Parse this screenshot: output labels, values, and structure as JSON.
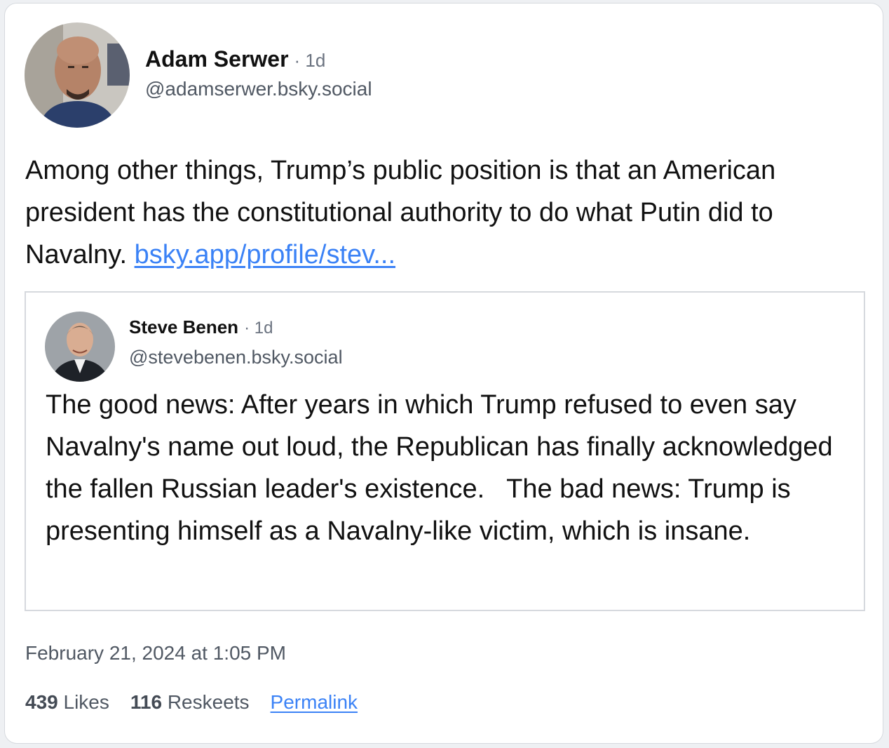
{
  "post": {
    "author": {
      "display_name": "Adam Serwer",
      "time_ago": "· 1d",
      "handle": "@adamserwer.bsky.social"
    },
    "text": "Among other things, Trump’s public position is that an American president has the constitutional authority to do what Putin did to Navalny. ",
    "link_text": "bsky.app/profile/stev...",
    "timestamp": "February 21, 2024 at 1:05 PM",
    "likes_count": "439",
    "likes_label": "Likes",
    "reskeets_count": "116",
    "reskeets_label": "Reskeets",
    "permalink_label": "Permalink"
  },
  "quote": {
    "author": {
      "display_name": "Steve Benen",
      "time_ago": "· 1d",
      "handle": "@stevebenen.bsky.social"
    },
    "text": "The good news: After years in which Trump refused to even say Navalny's name out loud, the Republican has finally acknowledged the fallen Russian leader's existence.   The bad news: Trump is presenting himself as a Navalny-like victim, which is insane."
  },
  "colors": {
    "link": "#3b82f6",
    "text": "#111111",
    "muted": "#505863",
    "border": "#d6d9de"
  }
}
